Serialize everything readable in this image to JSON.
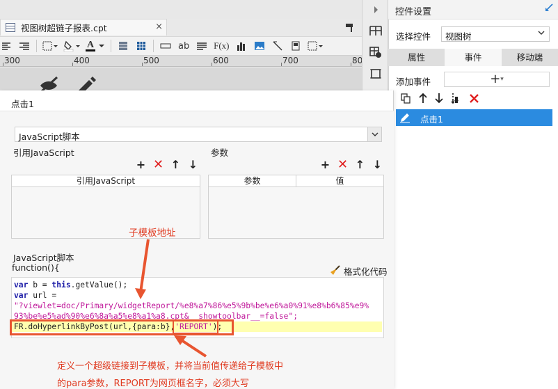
{
  "designer": {
    "tab_title": "视图树超链子报表.cpt",
    "tab_close": "×",
    "ruler_labels": [
      "300",
      "400",
      "500",
      "600",
      "700",
      "800"
    ],
    "toolbar": {
      "font_color_label": "A",
      "text_label": "ab",
      "formula_label": "F(x)"
    }
  },
  "right_panel": {
    "title": "控件设置",
    "select_widget_label": "选择控件",
    "select_widget_value": "视图树",
    "tabs": [
      "属性",
      "事件",
      "移动端"
    ],
    "active_tab": "事件",
    "add_event_label": "添加事件",
    "events": [
      "点击1"
    ],
    "accent_color": "#2b8be0"
  },
  "dialog": {
    "title": "点击1",
    "type_value": "JavaScript脚本",
    "ref_js_label": "引用JavaScript",
    "params_label": "参数",
    "ref_js_columns": [
      "引用JavaScript"
    ],
    "params_columns": [
      "参数",
      "值"
    ],
    "script_label": "JavaScript脚本",
    "function_label": "function(){",
    "format_code_label": "格式化代码",
    "code": {
      "l1_kw": "var",
      "l1_a": " b = ",
      "l1_kw2": "this",
      "l1_b": ".getValue();",
      "l2_kw": "var",
      "l2_a": " url =",
      "l3": "\"?viewlet=doc/Primary/widgetReport/%e8%a7%86%e5%9b%be%e6%a0%91%e8%b6%85%e9%",
      "l4": "93%be%e5%ad%90%e6%8a%a5%e8%a1%a8.cpt&__showtoolbar__=false\";",
      "l5_a": "FR.doHyperlinkByPost(url,{para:b},",
      "l5_b": "'REPORT'",
      "l5_c": ");"
    }
  },
  "annotations": {
    "sub_template_address": "子模板地址",
    "note_line1": "定义一个超级链接到子模板，并将当前值传递给子模板中",
    "note_line2": "的para参数，REPORT为网页框名字，必须大写",
    "annotation_color": "#e03a20"
  }
}
